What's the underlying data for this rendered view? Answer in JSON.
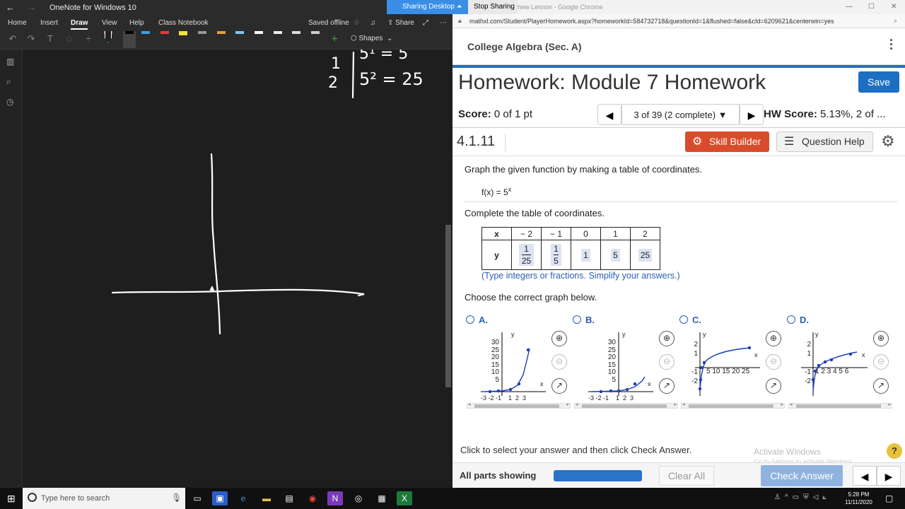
{
  "onenote": {
    "window_title": "OneNote for Windows 10",
    "menu": [
      "Home",
      "Insert",
      "Draw",
      "View",
      "Help",
      "Class Notebook"
    ],
    "saved_status": "Saved offline",
    "share_label": "Share",
    "shapes_label": "Shapes",
    "handwriting": {
      "row1_x": "1",
      "row1_expr": "5¹ = 5",
      "row2_x": "2",
      "row2_expr": "5² = 25"
    }
  },
  "sharing": {
    "sharing_desktop": "Sharing Desktop",
    "stop_sharing": "Stop Sharing"
  },
  "chrome": {
    "window_title": "hew Lennon - Google Chrome",
    "url": "mathxl.com/Student/PlayerHomework.aspx?homeworkId=584732718&questionId=1&flushed=false&cId=6209621&centerwin=yes"
  },
  "mathxl": {
    "course": "College Algebra (Sec. A)",
    "title": "Homework: Module 7 Homework",
    "save": "Save",
    "score_label": "Score:",
    "score_value": "0 of 1 pt",
    "question_nav": "3 of 39 (2 complete)",
    "hw_score_label": "HW Score:",
    "hw_score_value": "5.13%, 2 of ...",
    "question_id": "4.1.11",
    "skill_builder": "Skill Builder",
    "question_help": "Question Help",
    "prompt1": "Graph the given function by making a table of coordinates.",
    "function_base": "f(x) = 5",
    "function_exp": "x",
    "prompt2": "Complete the table of coordinates.",
    "table": {
      "x_header": "x",
      "y_header": "y",
      "x_values": [
        "− 2",
        "− 1",
        "0",
        "1",
        "2"
      ],
      "y_values": [
        {
          "num": "1",
          "den": "25"
        },
        {
          "num": "1",
          "den": "5"
        },
        {
          "value": "1"
        },
        {
          "value": "5"
        },
        {
          "value": "25"
        }
      ]
    },
    "table_note": "(Type integers or fractions. Simplify your answers.)",
    "prompt3": "Choose the correct graph below.",
    "options": [
      {
        "letter": "A.",
        "y_ticks": [
          "30",
          "25",
          "20",
          "15",
          "10",
          "5"
        ],
        "x_ticks": "-3 -2 -1    1  2  3",
        "x_label": "x",
        "y_label": "y"
      },
      {
        "letter": "B.",
        "y_ticks": [
          "30",
          "25",
          "20",
          "15",
          "10",
          "5"
        ],
        "x_ticks": "-3 -2 -1    1  2  3",
        "x_label": "x",
        "y_label": "y"
      },
      {
        "letter": "C.",
        "y_ticks": [
          "2",
          "1",
          "-1",
          "-2"
        ],
        "x_ticks": "5 10 15 20 25",
        "x_label": "x",
        "y_label": "y"
      },
      {
        "letter": "D.",
        "y_ticks": [
          "2",
          "1",
          "-1",
          "-2"
        ],
        "x_ticks": "1 2 3 4 5 6",
        "x_label": "x",
        "y_label": "y"
      }
    ],
    "instruction": "Click to select your answer and then click Check Answer.",
    "all_parts": "All parts showing",
    "clear_all": "Clear All",
    "check_answer": "Check Answer",
    "activate_title": "Activate Windows",
    "activate_sub": "Go to Settings to activate Windows."
  },
  "taskbar": {
    "search_placeholder": "Type here to search",
    "time": "5:28 PM",
    "date": "11/11/2020"
  },
  "colors": {
    "save_blue": "#1d6fc4",
    "skill_red": "#d94c2b",
    "progress_blue": "#2a73c8",
    "sharing_blue": "#3a8ee6"
  }
}
